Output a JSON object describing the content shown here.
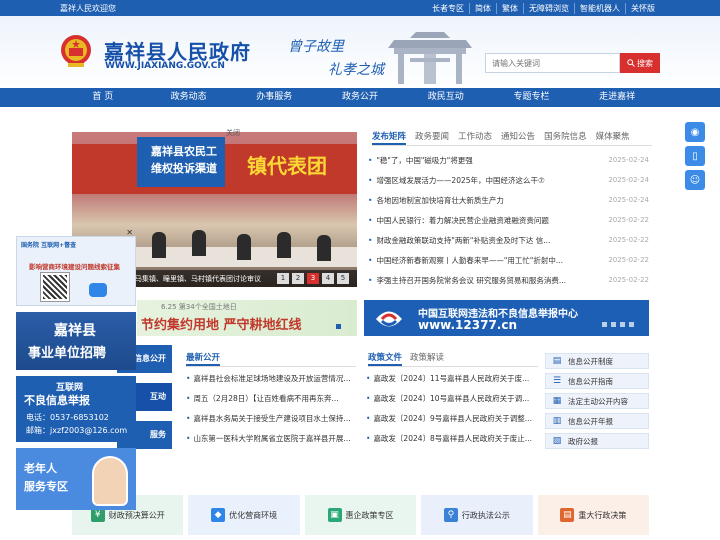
{
  "topbar": {
    "welcome": "嘉祥人民欢迎您",
    "links": [
      "长者专区",
      "简体",
      "繁体",
      "无障碍浏览",
      "智能机器人",
      "关怀版"
    ]
  },
  "header": {
    "site_name": "嘉祥县人民政府",
    "site_url": "WWW.JIAXIANG.GOV.CN",
    "slogan_line1": "曾子故里",
    "slogan_line2": "礼孝之城"
  },
  "search": {
    "placeholder": "请输入关键词",
    "button_label": "搜索"
  },
  "nav": [
    "首 页",
    "政务动态",
    "办事服务",
    "政务公开",
    "政民互动",
    "专题专栏",
    "走进嘉祥"
  ],
  "slider": {
    "banner_text": "镇代表团",
    "complaint_line1": "嘉祥县农民工",
    "complaint_line2": "维权投诉渠道",
    "close_label": "关闭",
    "caption": "马集镇、疃里镇、马村镇代表团讨论审议",
    "pages": [
      "1",
      "2",
      "3",
      "4",
      "5"
    ]
  },
  "news": {
    "tabs": [
      "发布矩阵",
      "政务要闻",
      "工作动态",
      "通知公告",
      "国务院信息",
      "媒体聚焦"
    ],
    "items": [
      {
        "title": "\"稳\"了，中国\"磁吸力\"将更强",
        "date": "2025-02-24"
      },
      {
        "title": "增强区域发展活力——2025年，中国经济这么干⑦",
        "date": "2025-02-24"
      },
      {
        "title": "各地因地制宜加快培育壮大新质生产力",
        "date": "2025-02-24"
      },
      {
        "title": "中国人民银行：着力解决民营企业融资难融资贵问题",
        "date": "2025-02-22"
      },
      {
        "title": "财政金融政策联动支持\"两新\"补贴资金及时下达 信...",
        "date": "2025-02-22"
      },
      {
        "title": "中国经济新春新观察丨人勤春来早——\"用工忙\"折射中...",
        "date": "2025-02-22"
      },
      {
        "title": "李强主持召开国务院常务会议 研究服务贸易和服务消费...",
        "date": "2025-02-22"
      }
    ]
  },
  "land_banner": {
    "line1": "6.25 第34个全国土地日",
    "line2": "节约集约用地  严守耕地红线"
  },
  "report_banner": {
    "line1": "中国互联网违法和不良信息举报中心",
    "line2": "www.12377.cn"
  },
  "left_col": [
    "信息公开",
    "互动",
    "服务"
  ],
  "latest": {
    "tab": "最新公开",
    "items": [
      "嘉祥县社会标准足球场地建设及开放运营情况...",
      "周五（2月28日）【让百姓看病不用再东奔...",
      "嘉祥县水务局关于接受生产建设项目水土保持...",
      "山东第一医科大学附属省立医院于嘉祥县开展..."
    ]
  },
  "policy": {
    "tabs": [
      "政策文件",
      "政策解读"
    ],
    "items": [
      "嘉政发〔2024〕11号嘉祥县人民政府关于废...",
      "嘉政发〔2024〕10号嘉祥县人民政府关于调...",
      "嘉政发〔2024〕9号嘉祥县人民政府关于调整...",
      "嘉政发〔2024〕8号嘉祥县人民政府关于废止..."
    ]
  },
  "right_links": [
    "信息公开制度",
    "信息公开指南",
    "法定主动公开内容",
    "信息公开年报",
    "政府公报"
  ],
  "tiles": [
    {
      "label": "财政预决算公开",
      "color": "#2f9e6b",
      "bg": "#e7f5ee"
    },
    {
      "label": "优化营商环境",
      "color": "#2f86e6",
      "bg": "#e8f1fc"
    },
    {
      "label": "惠企政策专区",
      "color": "#2aa876",
      "bg": "#e9f6ef"
    },
    {
      "label": "行政执法公示",
      "color": "#3b82d6",
      "bg": "#e9f0fb"
    },
    {
      "label": "重大行政决策",
      "color": "#e0662f",
      "bg": "#fcefe7"
    }
  ],
  "float_left": {
    "qr_head": "国务院 互联网+督查",
    "qr_title": "影响营商环境建设问题线索征集",
    "recruit_line1": "嘉祥县",
    "recruit_line2": "事业单位招聘",
    "report_line1": "互联网",
    "report_line2": "不良信息举报",
    "report_phone": "电话：0537-6853102",
    "report_email": "邮箱：jxzf2003@126.com",
    "elder_line1": "老年人",
    "elder_line2": "服务专区"
  }
}
